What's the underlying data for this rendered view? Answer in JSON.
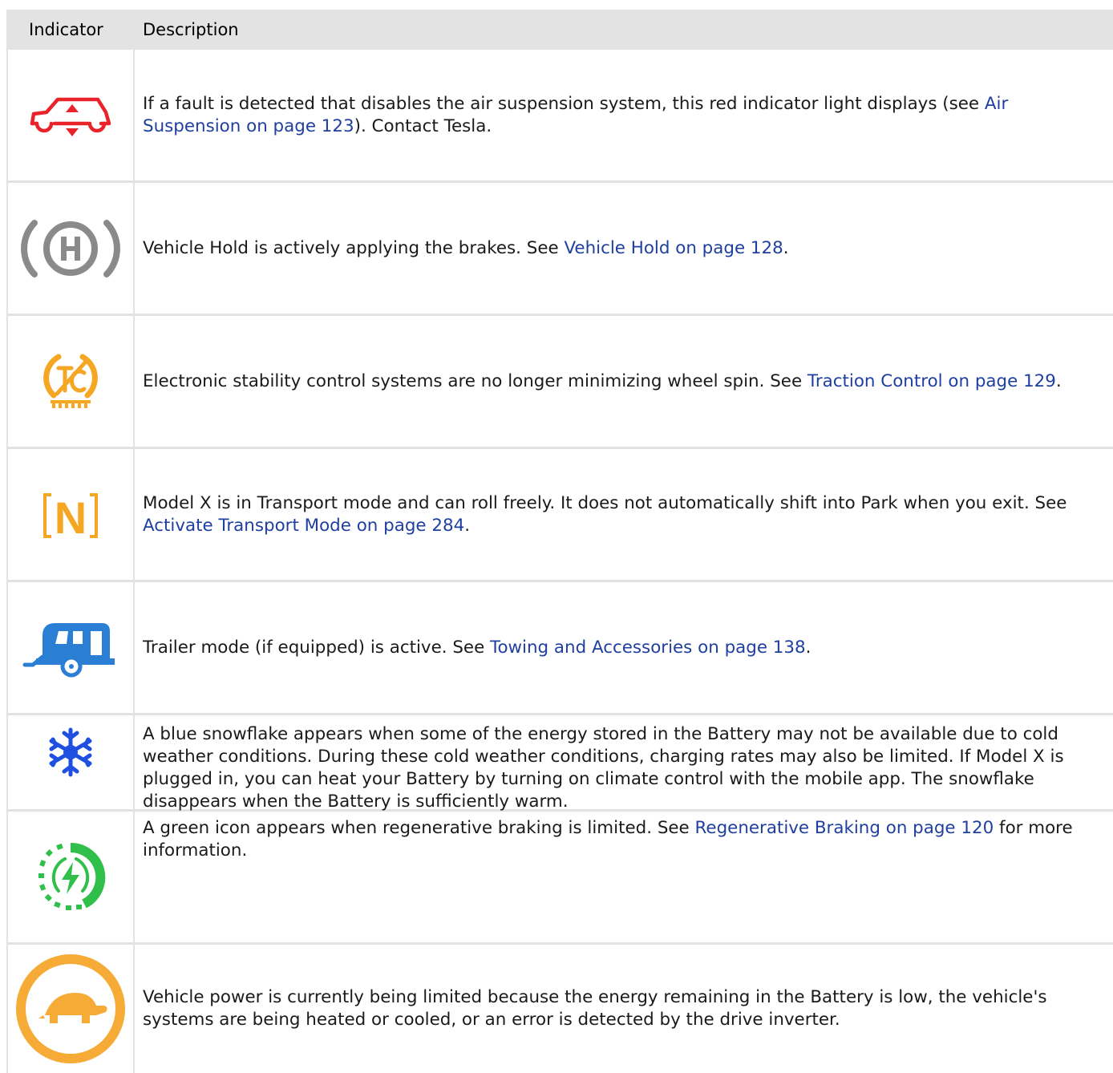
{
  "header": {
    "indicator": "Indicator",
    "description": "Description"
  },
  "rows": [
    {
      "icon": "air-suspension-icon",
      "color": "#e8232a",
      "before": "If a fault is detected that disables the air suspension system, this red indicator light displays (see ",
      "link": "Air Suspension on page 123",
      "after": "). Contact Tesla."
    },
    {
      "icon": "vehicle-hold-icon",
      "color": "#8a8a8a",
      "before": "Vehicle Hold is actively applying the brakes. See ",
      "link": "Vehicle Hold on page 128",
      "after": "."
    },
    {
      "icon": "traction-control-icon",
      "color": "#f5a623",
      "before": "Electronic stability control systems are no longer minimizing wheel spin. See ",
      "link": "Traction Control on page 129",
      "after": "."
    },
    {
      "icon": "transport-mode-icon",
      "color": "#f5a623",
      "icon_text": "N",
      "before": "Model X is in Transport mode and can roll freely. It does not automatically shift into Park when you exit. See ",
      "link": "Activate Transport Mode on page 284",
      "after": "."
    },
    {
      "icon": "trailer-mode-icon",
      "color": "#2a7fd4",
      "before": "Trailer mode (if equipped) is active. See ",
      "link": "Towing and Accessories on page 138",
      "after": "."
    },
    {
      "icon": "snowflake-icon",
      "color": "#1f4fe0",
      "before": "A blue snowflake appears when some of the energy stored in the Battery may not be available due to cold weather conditions. During these cold weather conditions, charging rates may also be limited. If Model X is plugged in, you can heat your Battery by turning on climate control with the mobile app. The snowflake disappears when the Battery is sufficiently warm.",
      "link": "",
      "after": ""
    },
    {
      "icon": "regen-braking-limited-icon",
      "color": "#2fbf4a",
      "before": "A green icon appears when regenerative braking is limited. See ",
      "link": "Regenerative Braking on page 120",
      "after": " for more information."
    },
    {
      "icon": "turtle-power-limited-icon",
      "color": "#f5ab35",
      "before": "Vehicle power is currently being limited because the energy remaining in the Battery is low, the vehicle's systems are being heated or cooled, or an error is detected by the drive inverter.",
      "link": "",
      "after": ""
    }
  ]
}
